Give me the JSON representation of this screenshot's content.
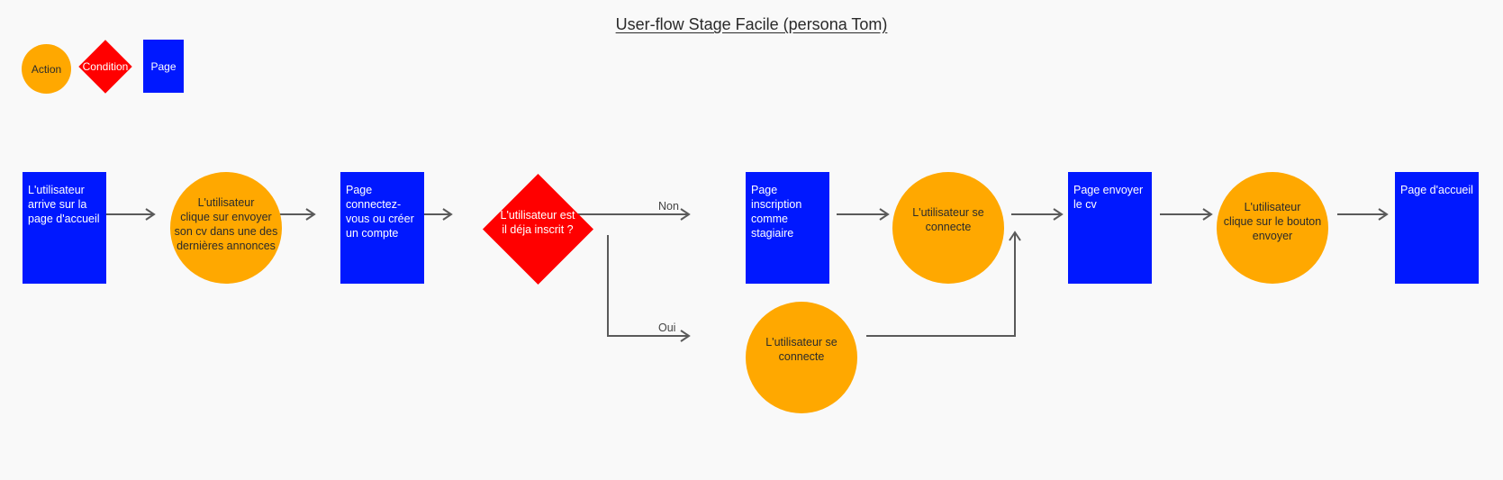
{
  "title": "User-flow Stage Facile (persona Tom)",
  "legend": {
    "action": "Action",
    "condition": "Condition",
    "page": "Page"
  },
  "colors": {
    "action": "#ffa800",
    "condition": "#ff0000",
    "page": "#0018ff",
    "edge": "#5a5a5a",
    "background": "#f9f9f9"
  },
  "nodes": {
    "n1": {
      "type": "page",
      "text": "L'utilisateur\narrive sur la\npage d'accueil"
    },
    "n2": {
      "type": "action",
      "text": "L'utilisateur\nclique sur envoyer\nson cv dans une des\ndernières annonces"
    },
    "n3": {
      "type": "page",
      "text": "Page\nconnectez-\nvous ou créer\nun compte"
    },
    "n4": {
      "type": "condition",
      "text": "L'utilisateur est\nil déja inscrit ?"
    },
    "n5": {
      "type": "page",
      "text": "Page\ninscription\ncomme\nstagiaire"
    },
    "n6": {
      "type": "action",
      "text": "L'utilisateur se\nconnecte"
    },
    "n7": {
      "type": "action",
      "text": "L'utilisateur se\nconnecte"
    },
    "n8": {
      "type": "page",
      "text": "Page envoyer\nle cv"
    },
    "n9": {
      "type": "action",
      "text": "L'utilisateur\nclique sur le bouton\nenvoyer"
    },
    "n10": {
      "type": "page",
      "text": "Page d'accueil"
    }
  },
  "edges": [
    {
      "from": "n1",
      "to": "n2"
    },
    {
      "from": "n2",
      "to": "n3"
    },
    {
      "from": "n3",
      "to": "n4"
    },
    {
      "from": "n4",
      "to": "n5",
      "label": "Non"
    },
    {
      "from": "n4",
      "to": "n7",
      "label": "Oui"
    },
    {
      "from": "n5",
      "to": "n6"
    },
    {
      "from": "n6",
      "to": "n8"
    },
    {
      "from": "n7",
      "to": "n8"
    },
    {
      "from": "n8",
      "to": "n9"
    },
    {
      "from": "n9",
      "to": "n10"
    }
  ],
  "edge_labels": {
    "non": "Non",
    "oui": "Oui"
  }
}
